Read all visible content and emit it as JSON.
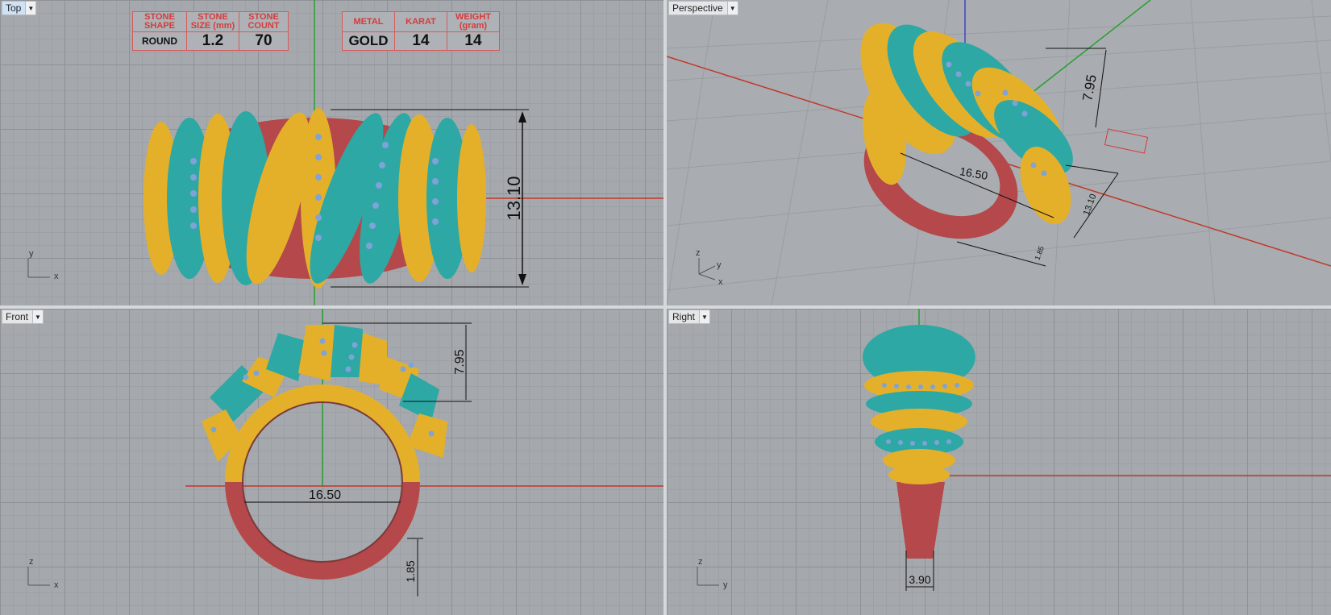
{
  "viewports": {
    "top": {
      "label": "Top"
    },
    "perspective": {
      "label": "Perspective"
    },
    "front": {
      "label": "Front"
    },
    "right": {
      "label": "Right"
    }
  },
  "stone_table": {
    "headers": [
      {
        "line1": "STONE",
        "line2": "SHAPE"
      },
      {
        "line1": "STONE",
        "line2": "SIZE (mm)"
      },
      {
        "line1": "STONE",
        "line2": "COUNT"
      }
    ],
    "values": [
      "ROUND",
      "1.2",
      "70"
    ]
  },
  "metal_table": {
    "headers": [
      {
        "line1": "METAL",
        "line2": ""
      },
      {
        "line1": "KARAT",
        "line2": ""
      },
      {
        "line1": "WEIGHT",
        "line2": "(gram)"
      }
    ],
    "values": [
      "GOLD",
      "14",
      "14"
    ]
  },
  "dimensions": {
    "top_height": "13.10",
    "persp_height": "7.95",
    "persp_width": "16.50",
    "persp_depth": "13.10",
    "persp_small": "1.85",
    "front_height": "7.95",
    "front_width": "16.50",
    "front_band": "1.85",
    "right_band": "3.90"
  },
  "axes": {
    "x": "x",
    "y": "y",
    "z": "z"
  },
  "colors": {
    "teal": "#2ea8a4",
    "gold": "#e4b02a",
    "red_band": "#b4484a",
    "stone": "#7ea3d8",
    "grid_red_axis": "#c0392b",
    "grid_green_axis": "#27a02e"
  }
}
